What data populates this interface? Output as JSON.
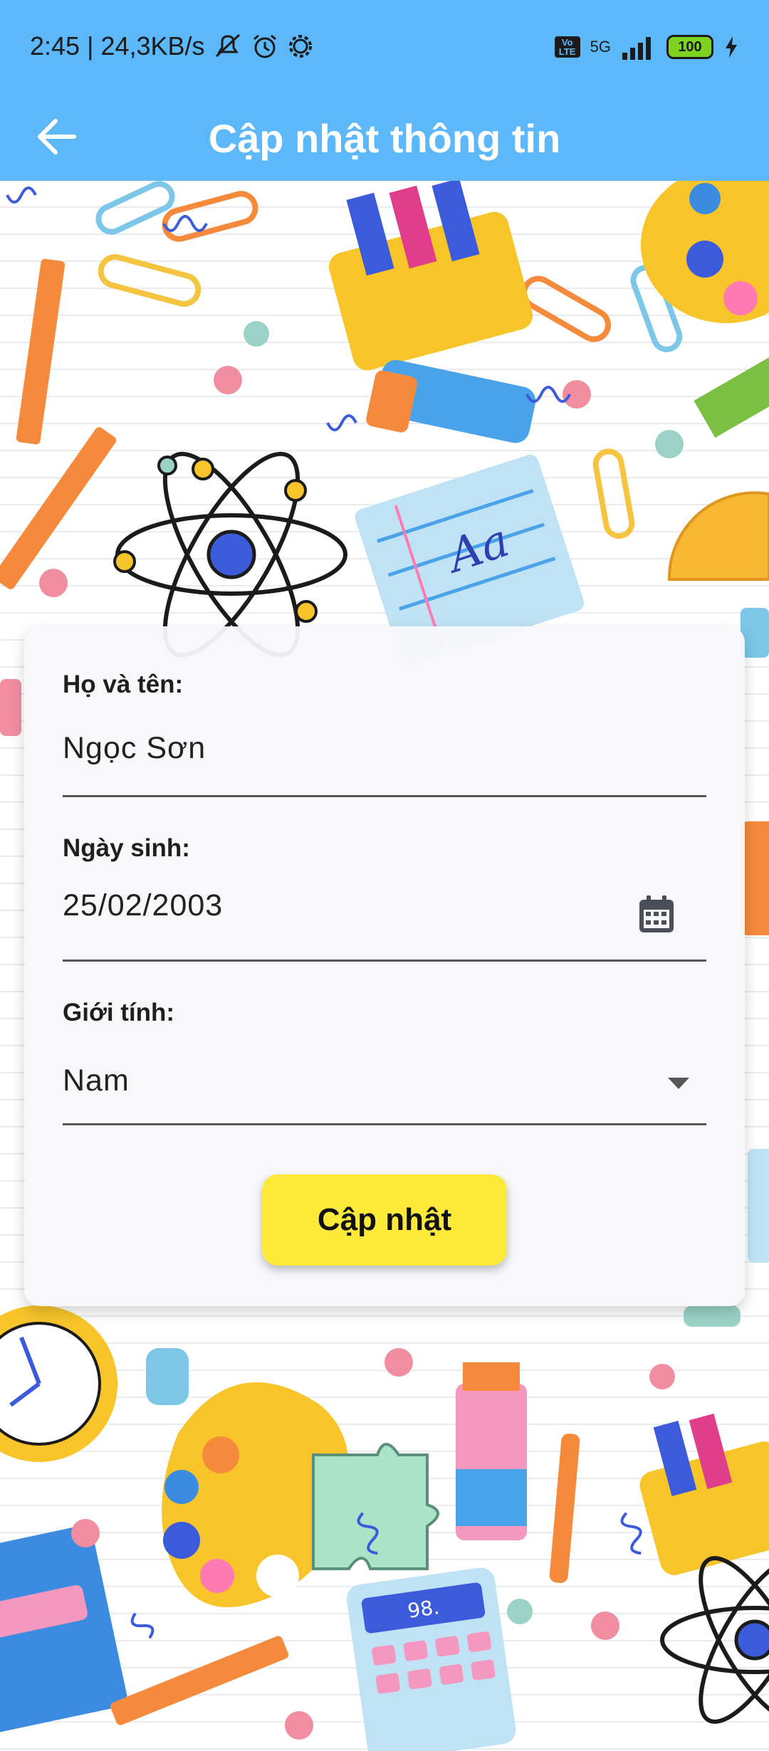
{
  "status_bar": {
    "time": "2:45",
    "speed": "24,3KB/s",
    "battery": "100",
    "network": "5G",
    "volte": "Vo LTE"
  },
  "app_bar": {
    "title": "Cập nhật thông tin",
    "back_icon": "arrow-left-icon"
  },
  "form": {
    "name": {
      "label": "Họ và tên:",
      "value": "Ngọc Sơn"
    },
    "birthdate": {
      "label": "Ngày sinh:",
      "value": "25/02/2003",
      "icon": "calendar-icon"
    },
    "gender": {
      "label": "Giới tính:",
      "value": "Nam",
      "icon": "dropdown-arrow-icon"
    },
    "submit_label": "Cập nhật"
  },
  "colors": {
    "app_bar": "#5cb8f8",
    "button": "#fde93a"
  }
}
